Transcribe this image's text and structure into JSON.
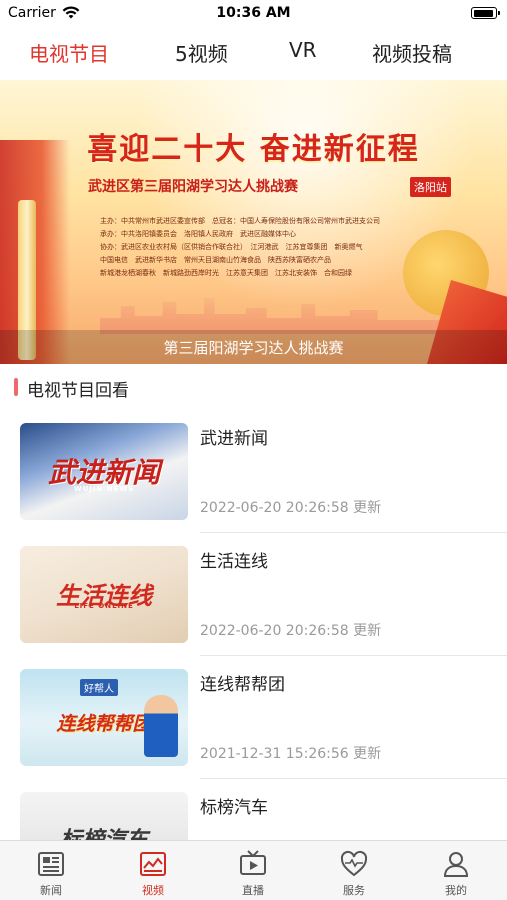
{
  "status_bar": {
    "carrier": "Carrier",
    "time": "10:36 AM"
  },
  "top_tabs": [
    {
      "label": "电视节目",
      "active": true
    },
    {
      "label": "5视频",
      "active": false
    },
    {
      "label": "VR",
      "active": false
    },
    {
      "label": "视频投稿",
      "active": false
    }
  ],
  "banner": {
    "headline": "喜迎二十大 奋进新征程",
    "subtitle": "武进区第三届阳湖学习达人挑战赛",
    "badge": "洛阳站",
    "organizers": [
      "主办：中共常州市武进区委宣传部　总冠名：中国人寿保险股份有限公司常州市武进支公司",
      "承办：中共洛阳镇委员会　洛阳镇人民政府　武进区融媒体中心",
      "协办：武进区农业农村局（区供销合作联合社）　江河港武　江苏宜尊集团　新奥燃气",
      "中国电信　武进新华书店　常州天目湖南山竹海食品　陕西苏陕富硒农产品",
      "新城港龙栖湖春秋　新城路劲西岸时光　江苏意天集团　江苏北安装饰　合和园绿"
    ],
    "caption": "第三届阳湖学习达人挑战赛"
  },
  "section": {
    "title": "电视节目回看"
  },
  "programs": [
    {
      "title": "武进新闻",
      "date": "2022-06-20 20:26:58 更新",
      "thumb_text": "武进新闻",
      "thumb_sub": "WUJIN NEWS"
    },
    {
      "title": "生活连线",
      "date": "2022-06-20 20:26:58 更新",
      "thumb_text": "生活连线",
      "thumb_sub": "LIFE ONLINE"
    },
    {
      "title": "连线帮帮团",
      "date": "2021-12-31 15:26:56 更新",
      "thumb_text": "连线帮帮团",
      "thumb_head": "好帮人"
    },
    {
      "title": "标榜汽车",
      "date": "",
      "thumb_text": "标榜汽车"
    }
  ],
  "bottom_nav": [
    {
      "label": "新闻",
      "icon": "newspaper-icon",
      "active": false
    },
    {
      "label": "视频",
      "icon": "video-chart-icon",
      "active": true
    },
    {
      "label": "直播",
      "icon": "tv-icon",
      "active": false
    },
    {
      "label": "服务",
      "icon": "heart-icon",
      "active": false
    },
    {
      "label": "我的",
      "icon": "person-icon",
      "active": false
    }
  ],
  "colors": {
    "accent": "#e1352d",
    "section_bar": "#f06a6a",
    "muted_text": "#9a9a9a"
  }
}
